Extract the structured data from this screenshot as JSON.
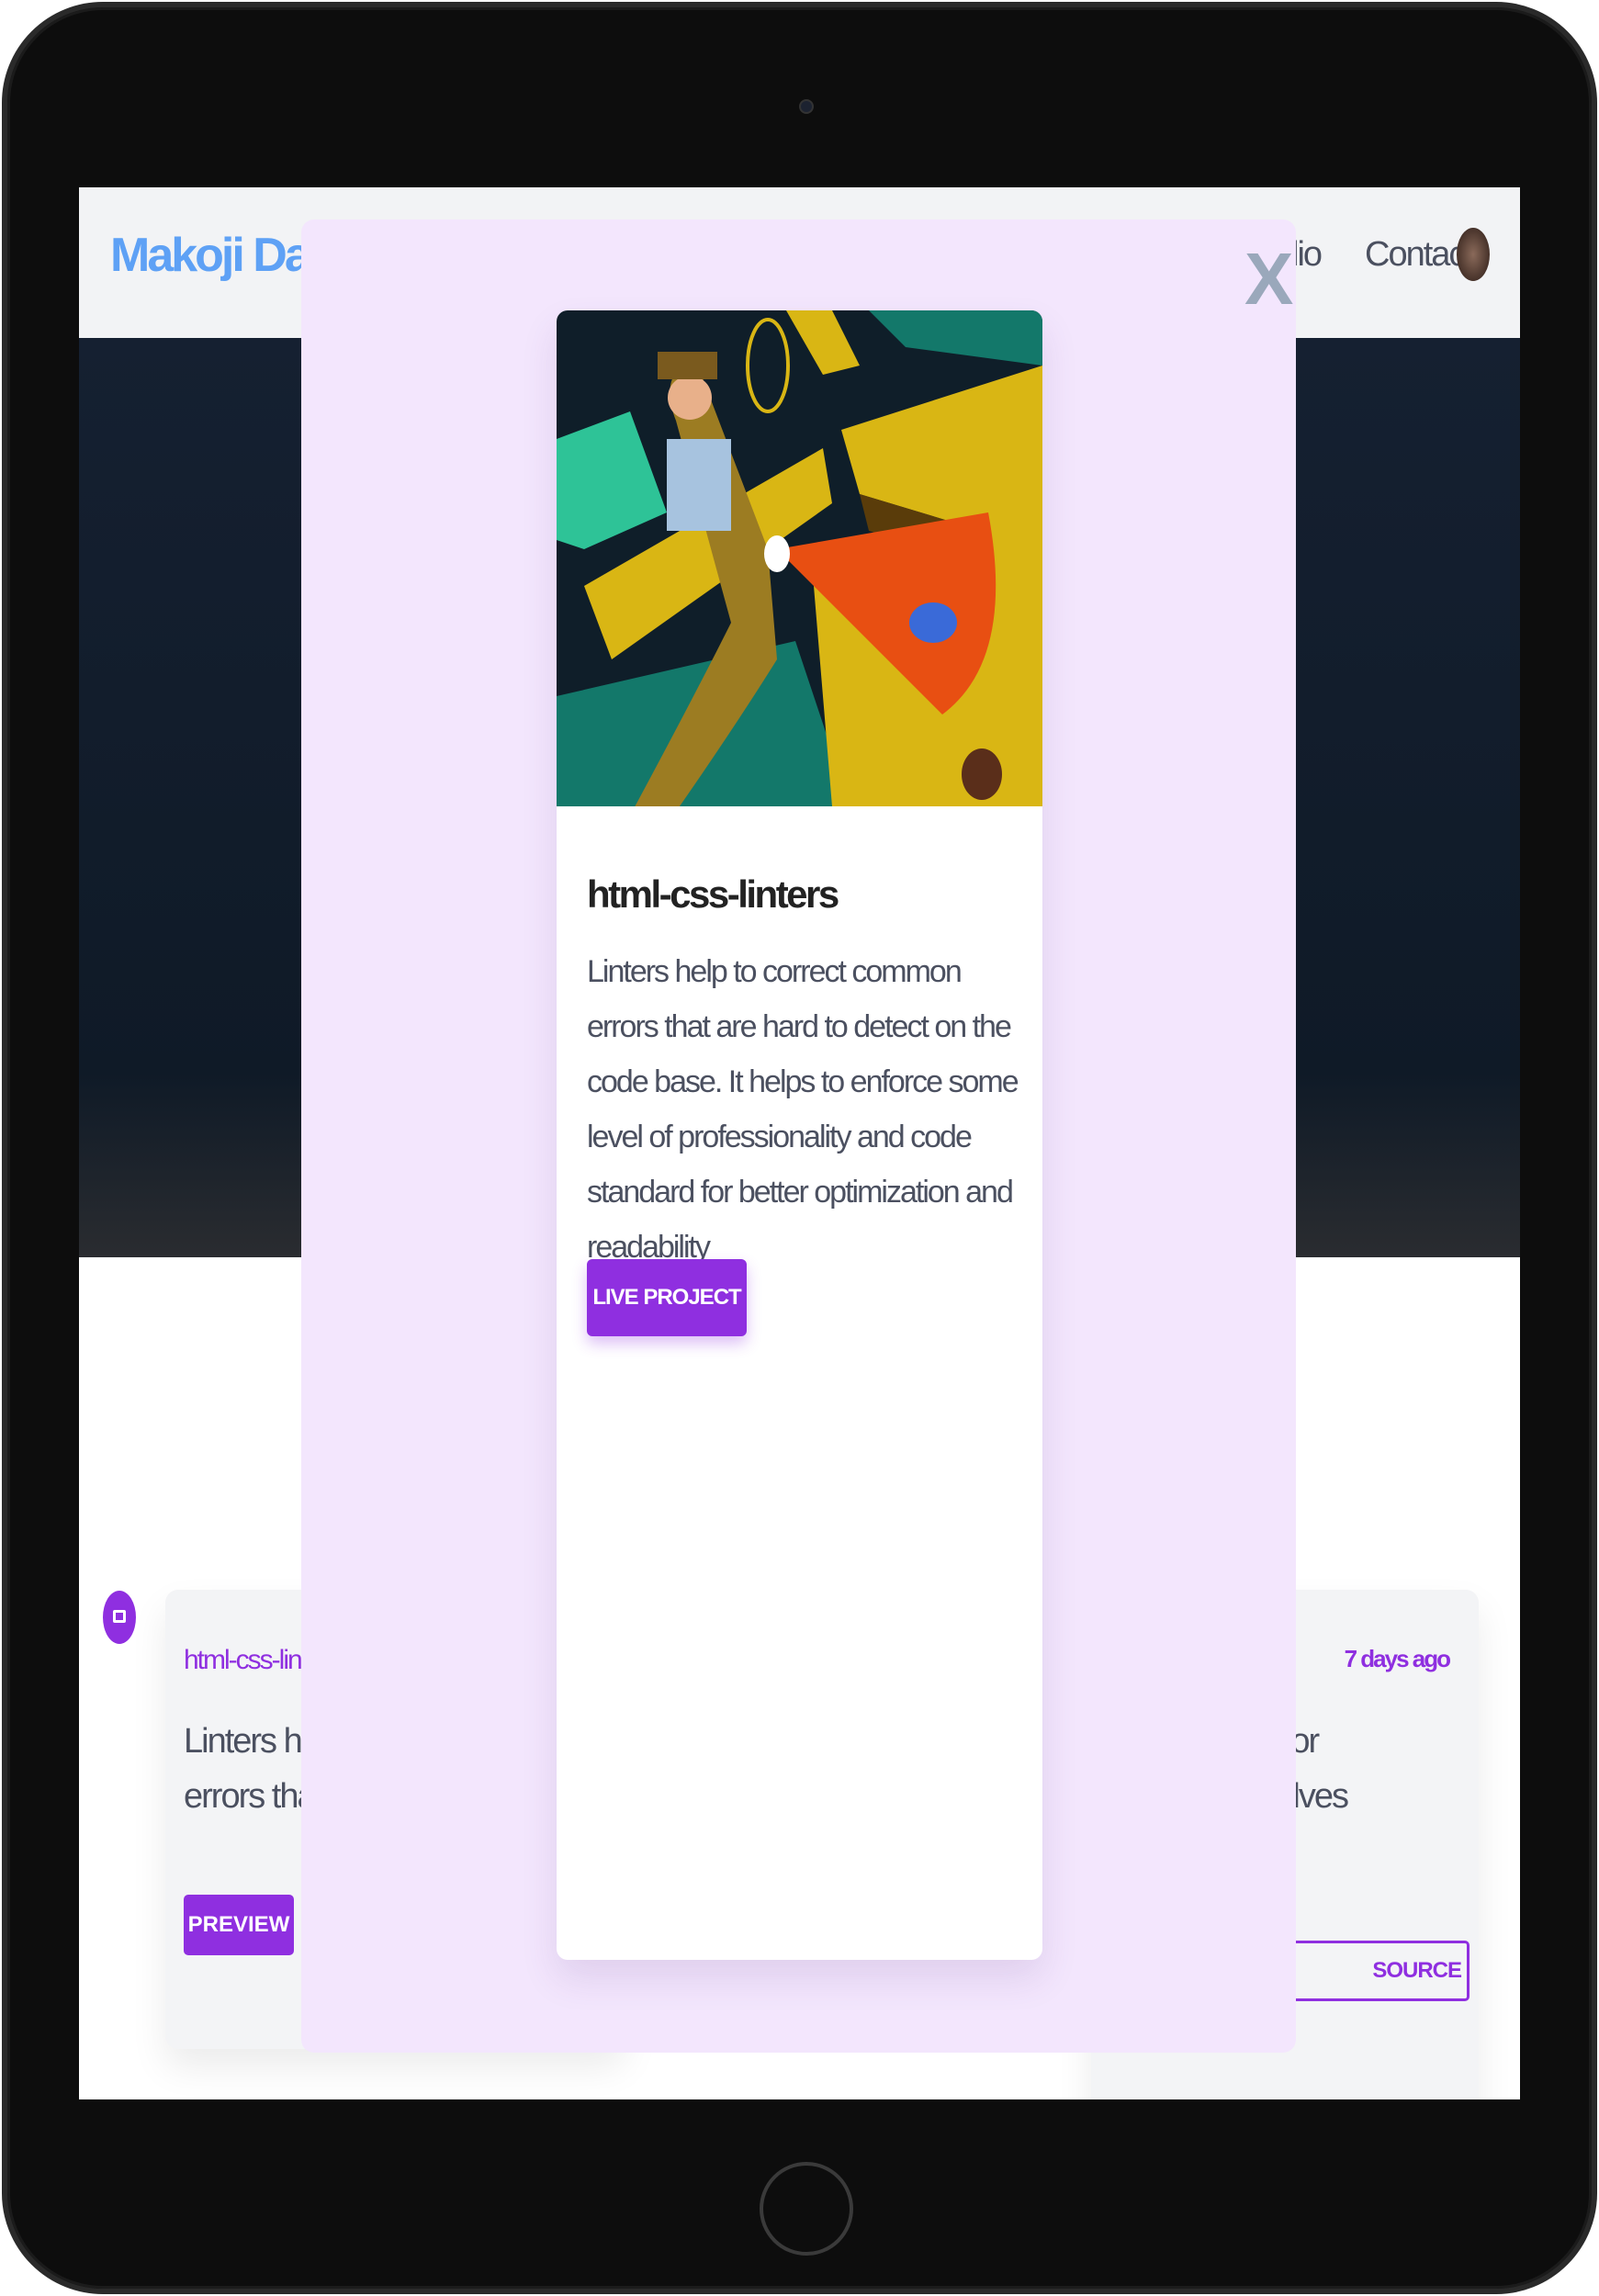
{
  "nav": {
    "brand": "Makoji David",
    "links": [
      "Portfolio",
      "Contact"
    ],
    "partial_link": "lio"
  },
  "modal": {
    "close_label": "X",
    "project": {
      "title": "html-css-linters",
      "description": "Linters help to correct common errors that are hard to detect on the code base. It helps to enforce some level of professionality and code standard for better optimization and readability",
      "live_button": "LIVE PROJECT"
    }
  },
  "background_cards": [
    {
      "title": "html-css-linte",
      "text_lines": [
        "Linters help",
        "errors that a"
      ],
      "button": "PREVIEW"
    },
    {
      "time": "7 days ago",
      "text_lines": [
        "oject for",
        "2 involves"
      ],
      "button": "SOURCE"
    }
  ],
  "colors": {
    "accent": "#8f2fe0",
    "brand": "#5ea1f5",
    "overlay": "#f3e6fd"
  }
}
